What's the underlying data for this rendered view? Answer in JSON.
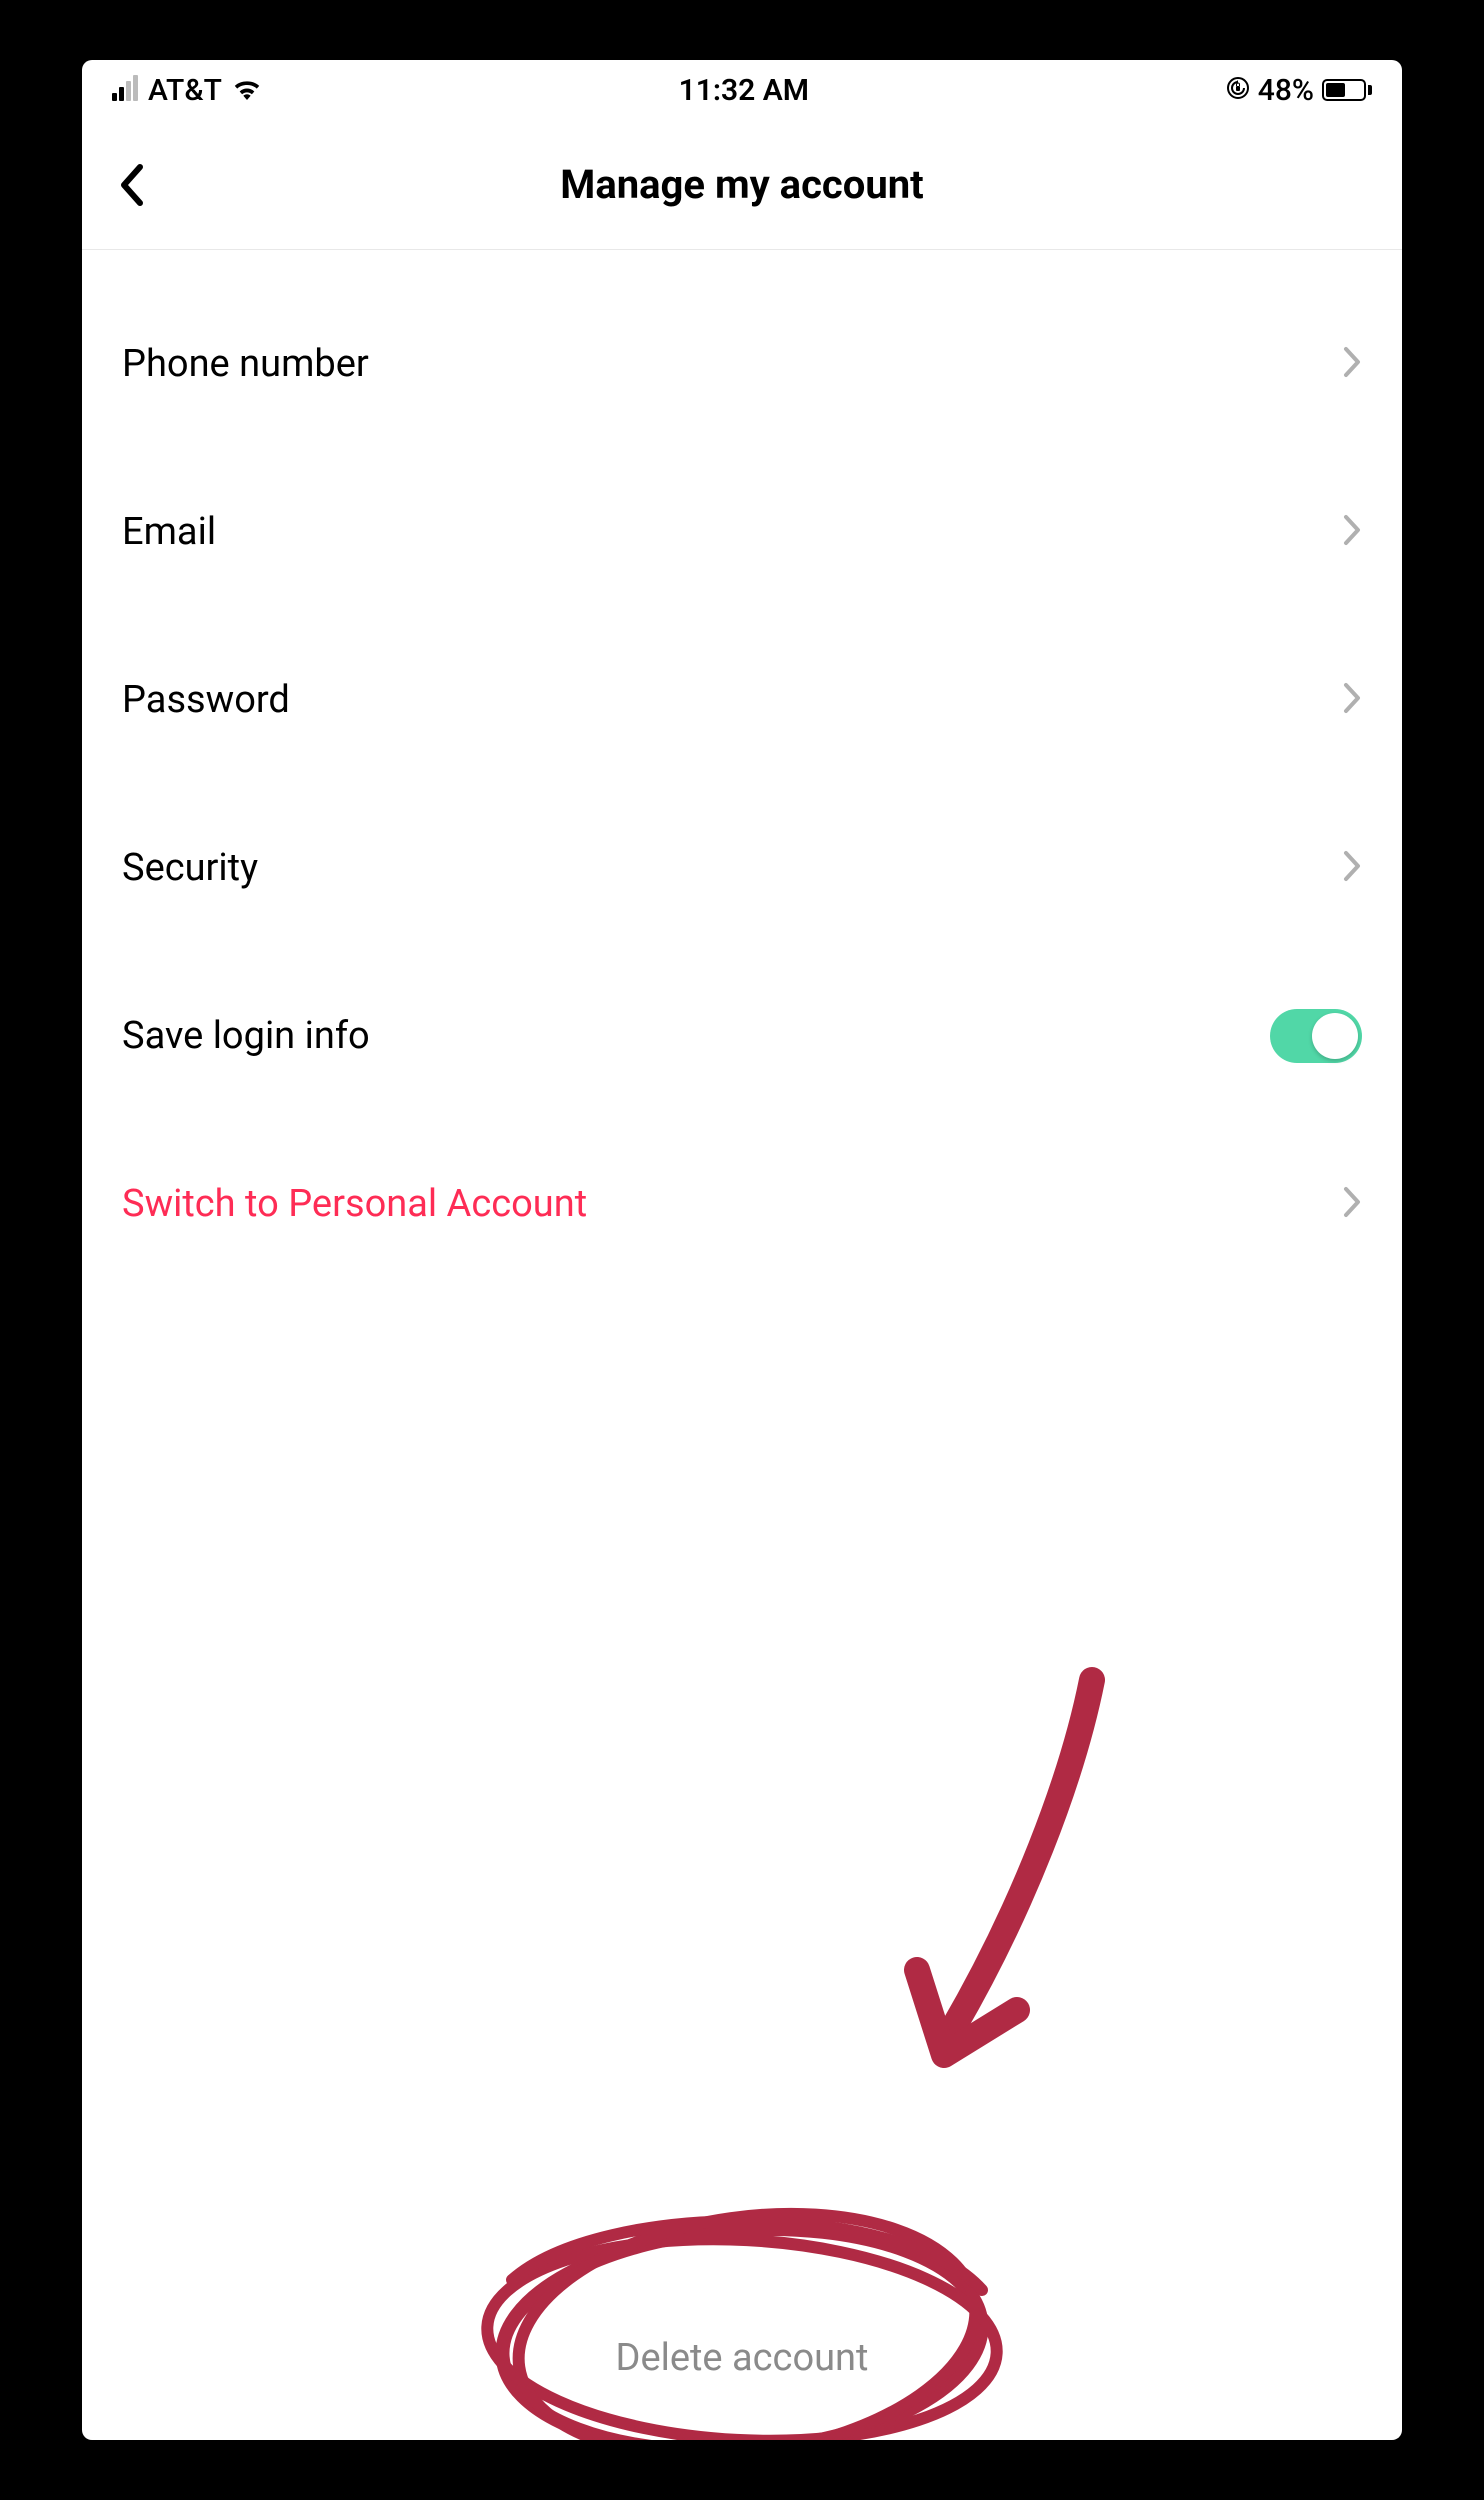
{
  "status": {
    "carrier": "AT&T",
    "time": "11:32 AM",
    "battery_pct": "48%"
  },
  "nav": {
    "title": "Manage my account"
  },
  "rows": {
    "phone": "Phone number",
    "email": "Email",
    "password": "Password",
    "security": "Security",
    "save_login": "Save login info",
    "switch": "Switch to Personal Account"
  },
  "footer": {
    "delete": "Delete account"
  },
  "colors": {
    "accent": "#fe2c55",
    "toggle_on": "#51d7a7",
    "annotation": "#b02a44"
  }
}
